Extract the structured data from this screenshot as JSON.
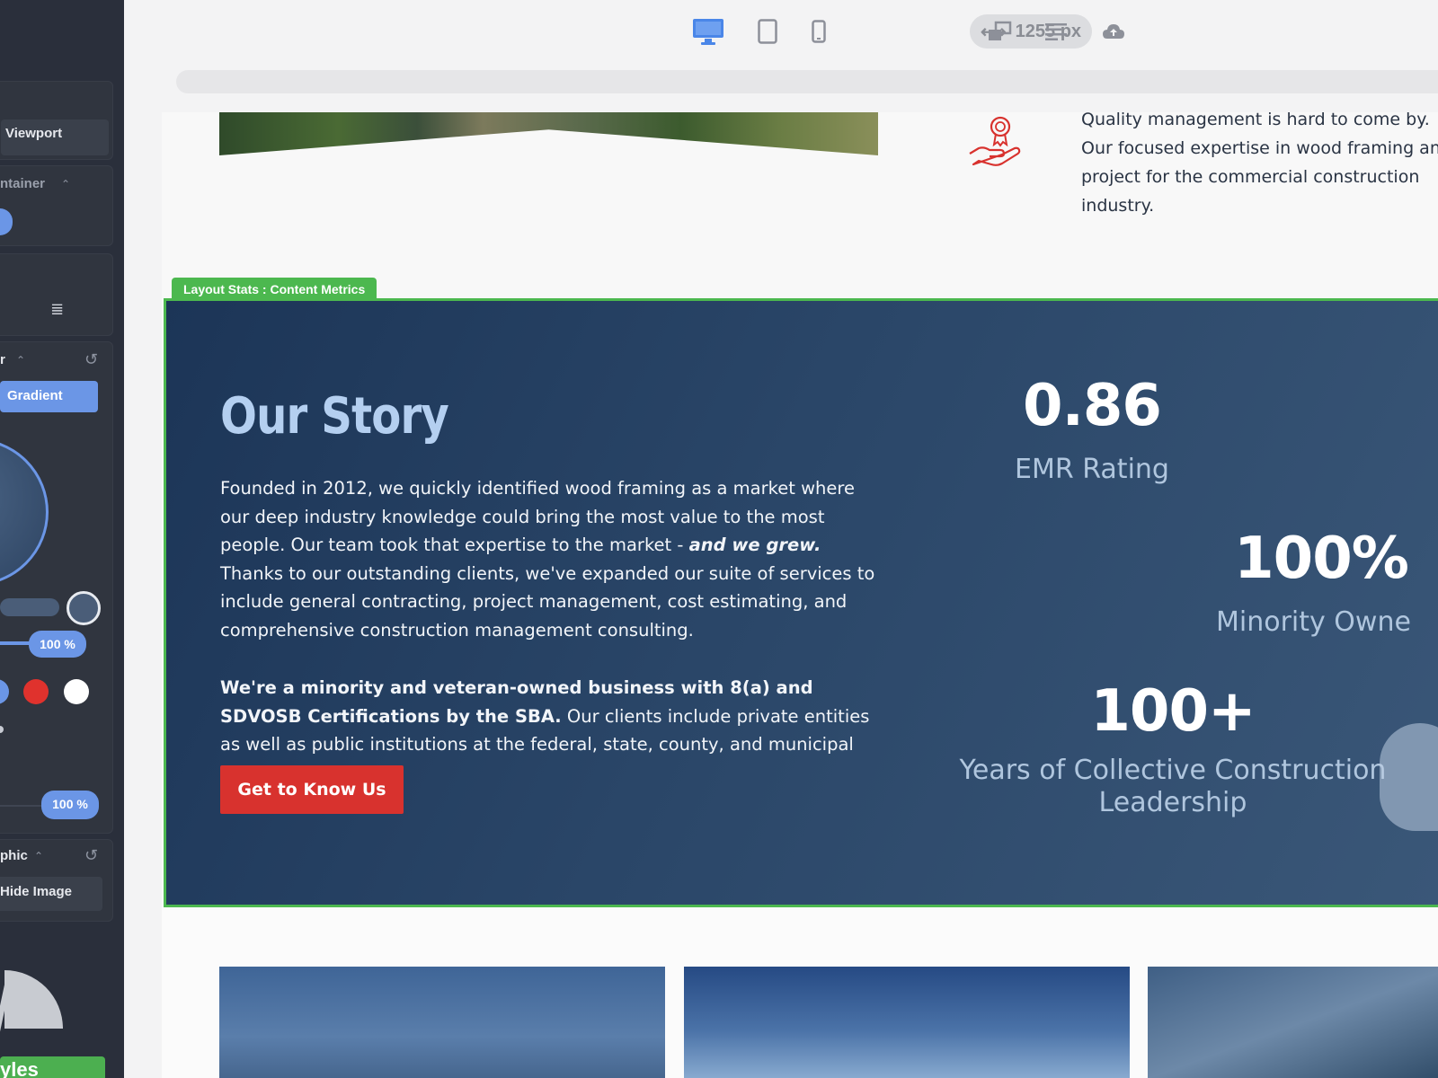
{
  "sidebar": {
    "viewport_label": "Viewport",
    "container_label": "ntainer",
    "color_label": "r",
    "gradient_button": "Gradient",
    "opacity_badge_1": "100 %",
    "opacity_badge_2": "100 %",
    "graphic_label": "phic",
    "hide_image_label": "Hide Image",
    "styles_button": "yles",
    "swatch_colors": [
      "#6b96e6",
      "#e0322d",
      "#ffffff"
    ]
  },
  "toolbar": {
    "width_value": "1255 px",
    "active_device": "desktop",
    "accent": "#4a86e8"
  },
  "top_section": {
    "quality_text": "Quality management is hard to come by. Our focused expertise in wood framing and project for the commercial construction industry."
  },
  "section_tag": "Layout Stats : Content Metrics",
  "story": {
    "title": "Our Story",
    "p1_a": "Founded in 2012, we quickly identified wood framing as a market where our deep industry knowledge could bring the most value to the most people. Our team took that expertise to the market - ",
    "p1_emph": "and we grew.",
    "p1_b": " Thanks to our outstanding clients, we've expanded our suite of services to include general contracting, project management, cost estimating, and comprehensive construction management consulting.",
    "p2_bold": "We're a minority and veteran-owned business with 8(a) and SDVOSB Certifications by the SBA.",
    "p2_rest": " Our clients include private entities as well as public institutions at the federal, state, county, and municipal levels.",
    "cta": "Get to Know Us"
  },
  "stats": [
    {
      "value": "0.86",
      "label": "EMR Rating"
    },
    {
      "value": "100%",
      "label": "Minority Owne"
    },
    {
      "value": "100+",
      "label": "Years of Collective Construction Leadership"
    }
  ],
  "colors": {
    "selection_green": "#4cb84f",
    "cta_red": "#d8322e",
    "story_bg": "#2a4668"
  }
}
